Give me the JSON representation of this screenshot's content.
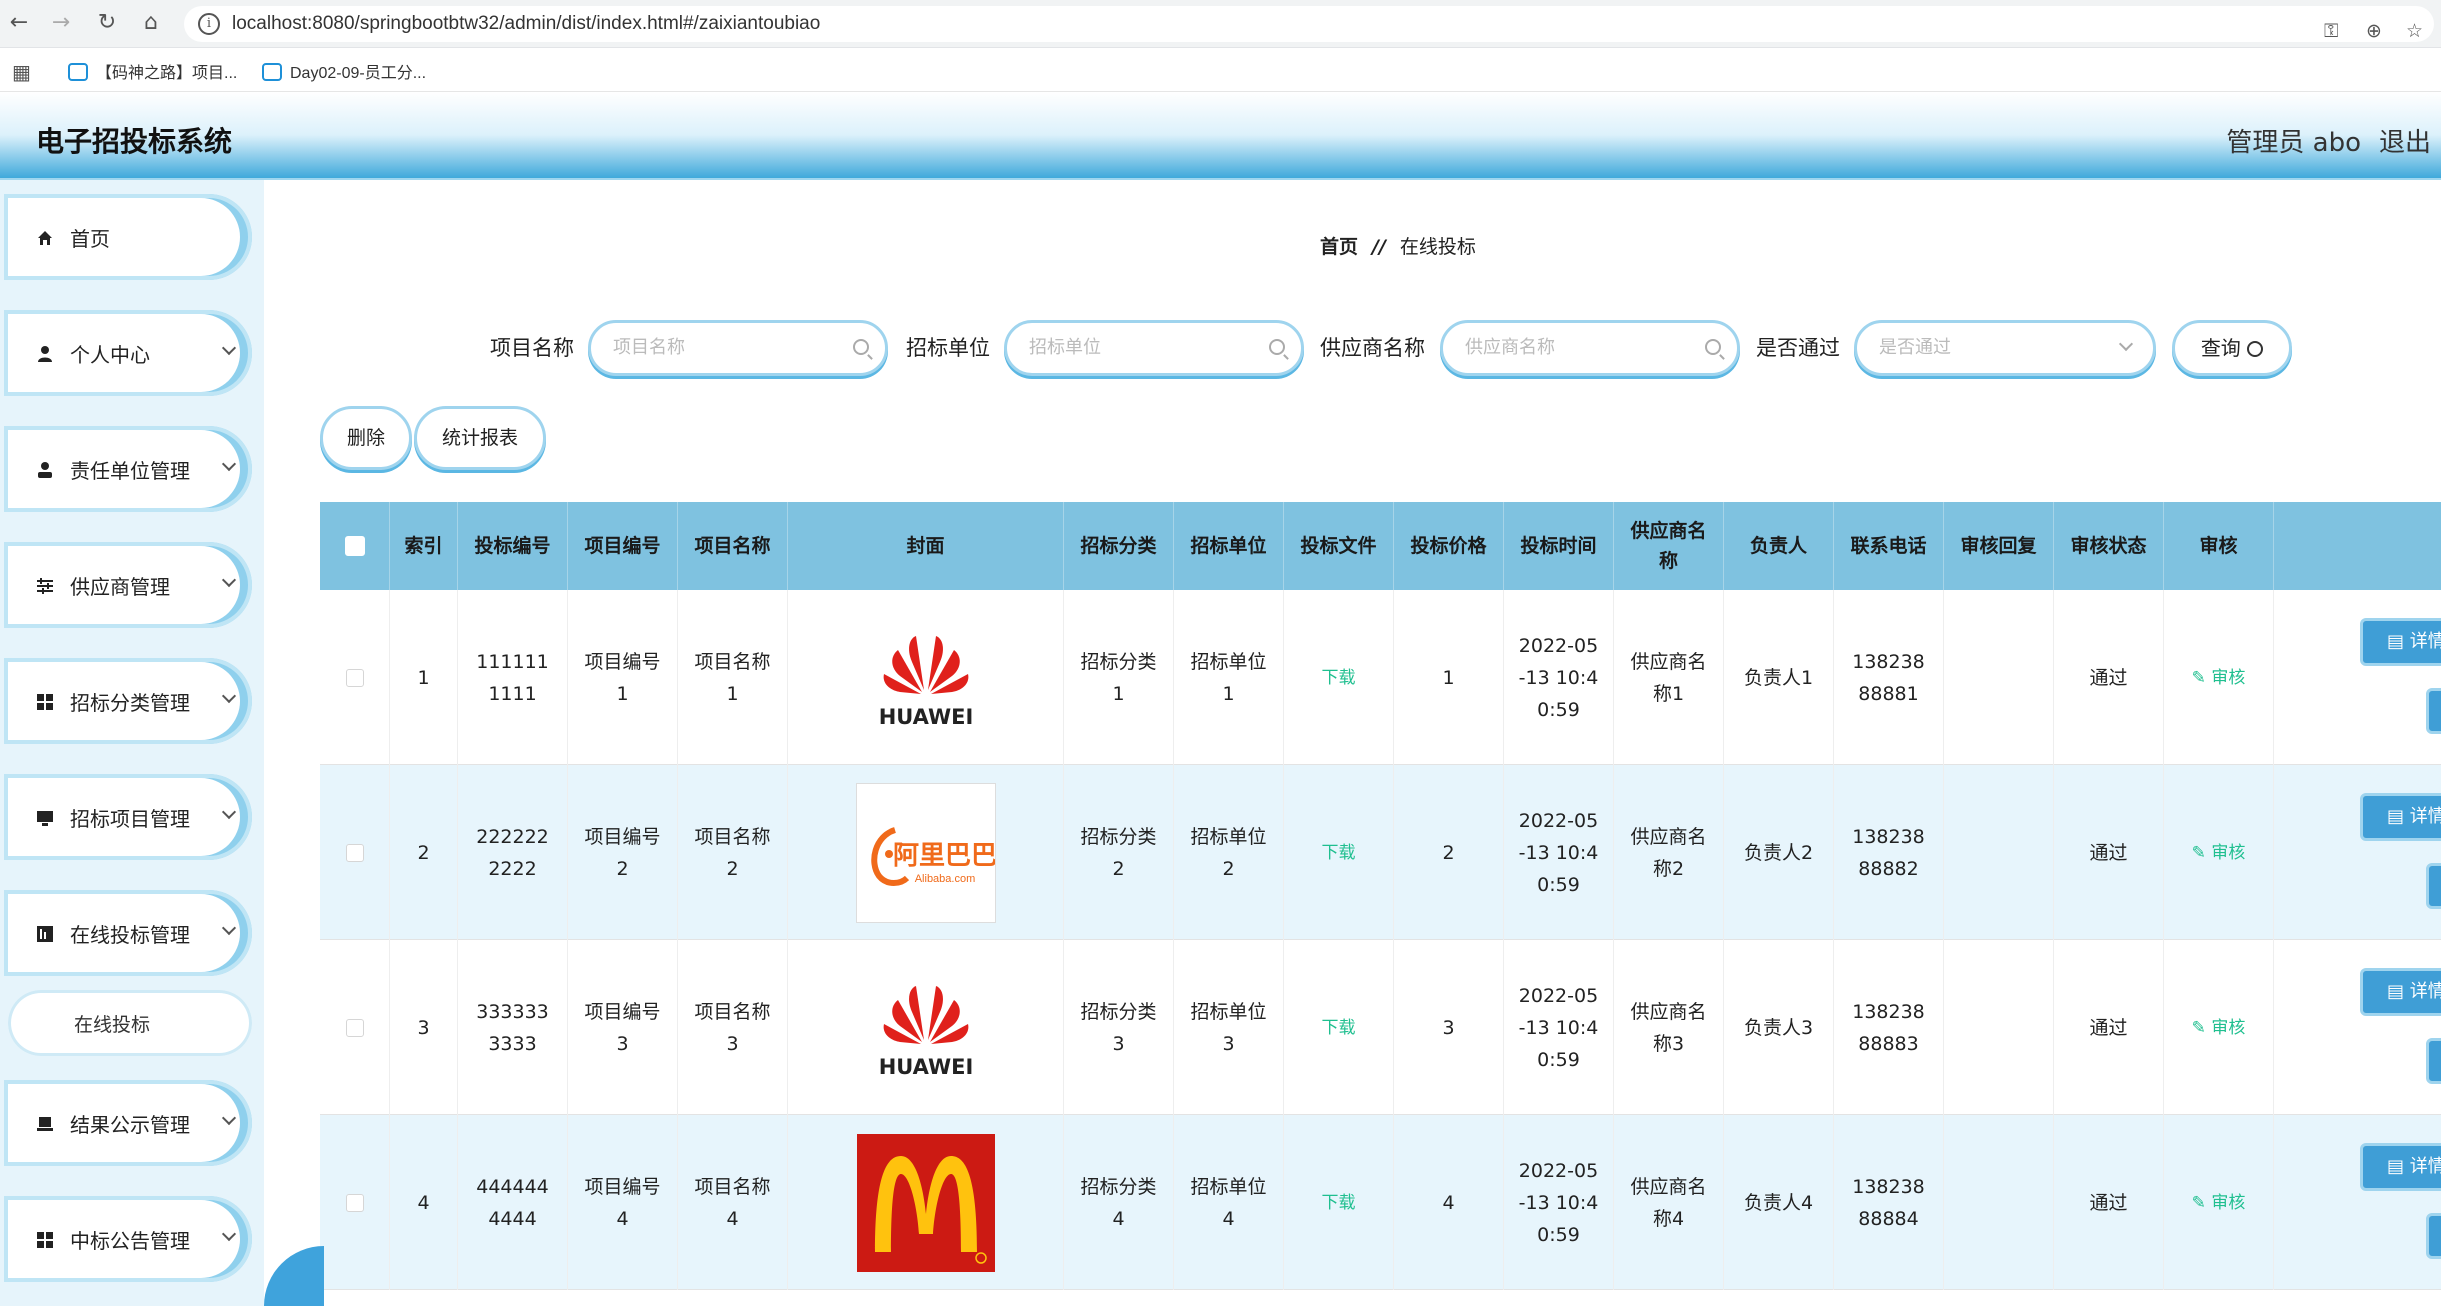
{
  "browser": {
    "url": "localhost:8080/springbootbtw32/admin/dist/index.html#/zaixiantoubiao",
    "bookmarks": [
      "【码神之路】项目...",
      "Day02-09-员工分..."
    ]
  },
  "header": {
    "title": "电子招投标系统",
    "admin": "管理员 abo",
    "logout": "退出"
  },
  "sidebar": {
    "items": [
      {
        "label": "首页",
        "icon": "home-icon"
      },
      {
        "label": "个人中心",
        "icon": "user-icon"
      },
      {
        "label": "责任单位管理",
        "icon": "person-icon"
      },
      {
        "label": "供应商管理",
        "icon": "sliders-icon"
      },
      {
        "label": "招标分类管理",
        "icon": "grid-icon"
      },
      {
        "label": "招标项目管理",
        "icon": "monitor-icon"
      },
      {
        "label": "在线投标管理",
        "icon": "chart-icon"
      },
      {
        "label": "结果公示管理",
        "icon": "laptop-icon"
      },
      {
        "label": "中标公告管理",
        "icon": "grid-icon"
      }
    ],
    "submenu_label": "在线投标"
  },
  "breadcrumb": {
    "home": "首页",
    "sep": "//",
    "current": "在线投标"
  },
  "search": {
    "project_name_label": "项目名称",
    "project_name_placeholder": "项目名称",
    "tender_unit_label": "招标单位",
    "tender_unit_placeholder": "招标单位",
    "supplier_label": "供应商名称",
    "supplier_placeholder": "供应商名称",
    "passed_label": "是否通过",
    "passed_placeholder": "是否通过",
    "query_button": "查询"
  },
  "actions": {
    "delete": "删除",
    "report": "统计报表"
  },
  "table": {
    "headers": [
      "",
      "索引",
      "投标编号",
      "项目编号",
      "项目名称",
      "封面",
      "招标分类",
      "招标单位",
      "投标文件",
      "投标价格",
      "投标时间",
      "供应商名称",
      "负责人",
      "联系电话",
      "审核回复",
      "审核状态",
      "审核"
    ],
    "rows": [
      {
        "index": "1",
        "bid_no": "1111111111",
        "project_no": "项目编号1",
        "project_name": "项目名称1",
        "cover": "huawei",
        "category": "招标分类1",
        "unit": "招标单位1",
        "file": "下载",
        "price": "1",
        "time": "2022-05-13 10:40:59",
        "supplier": "供应商名称1",
        "owner": "负责人1",
        "phone": "13823888881",
        "reply": "",
        "status": "通过",
        "audit": "审核",
        "detail": "详情"
      },
      {
        "index": "2",
        "bid_no": "2222222222",
        "project_no": "项目编号2",
        "project_name": "项目名称2",
        "cover": "alibaba",
        "category": "招标分类2",
        "unit": "招标单位2",
        "file": "下载",
        "price": "2",
        "time": "2022-05-13 10:40:59",
        "supplier": "供应商名称2",
        "owner": "负责人2",
        "phone": "13823888882",
        "reply": "",
        "status": "通过",
        "audit": "审核",
        "detail": "详情"
      },
      {
        "index": "3",
        "bid_no": "3333333333",
        "project_no": "项目编号3",
        "project_name": "项目名称3",
        "cover": "huawei",
        "category": "招标分类3",
        "unit": "招标单位3",
        "file": "下载",
        "price": "3",
        "time": "2022-05-13 10:40:59",
        "supplier": "供应商名称3",
        "owner": "负责人3",
        "phone": "13823888883",
        "reply": "",
        "status": "通过",
        "audit": "审核",
        "detail": "详情"
      },
      {
        "index": "4",
        "bid_no": "4444444444",
        "project_no": "项目编号4",
        "project_name": "项目名称4",
        "cover": "mcdonalds",
        "category": "招标分类4",
        "unit": "招标单位4",
        "file": "下载",
        "price": "4",
        "time": "2022-05-13 10:40:59",
        "supplier": "供应商名称4",
        "owner": "负责人4",
        "phone": "13823888884",
        "reply": "",
        "status": "通过",
        "audit": "审核",
        "detail": "详情"
      }
    ]
  },
  "logos": {
    "huawei_text": "HUAWEI",
    "alibaba_text": "阿里巴巴",
    "alibaba_sub": "Alibaba.com"
  },
  "colors": {
    "accent": "#3f9ed6",
    "header_bg": "#7fc2e0",
    "link": "#1fbf8f",
    "sidebar_bg": "#e6f4fb"
  }
}
